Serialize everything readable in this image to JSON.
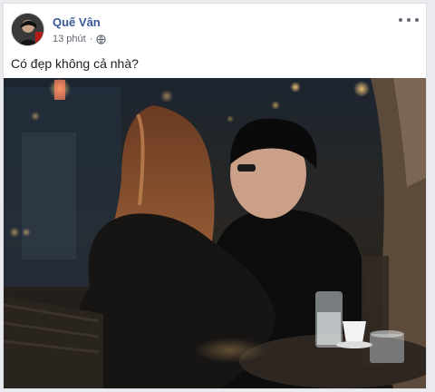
{
  "post": {
    "author": "Quế Vân",
    "time": "13 phút",
    "separator": "·",
    "text": "Có đẹp không cả nhà?",
    "privacy_icon": "globe-icon",
    "more_icon": "more-options-icon"
  },
  "colors": {
    "author": "#385898",
    "meta": "#616770",
    "text": "#1c1e21",
    "background": "#e9ebee"
  }
}
